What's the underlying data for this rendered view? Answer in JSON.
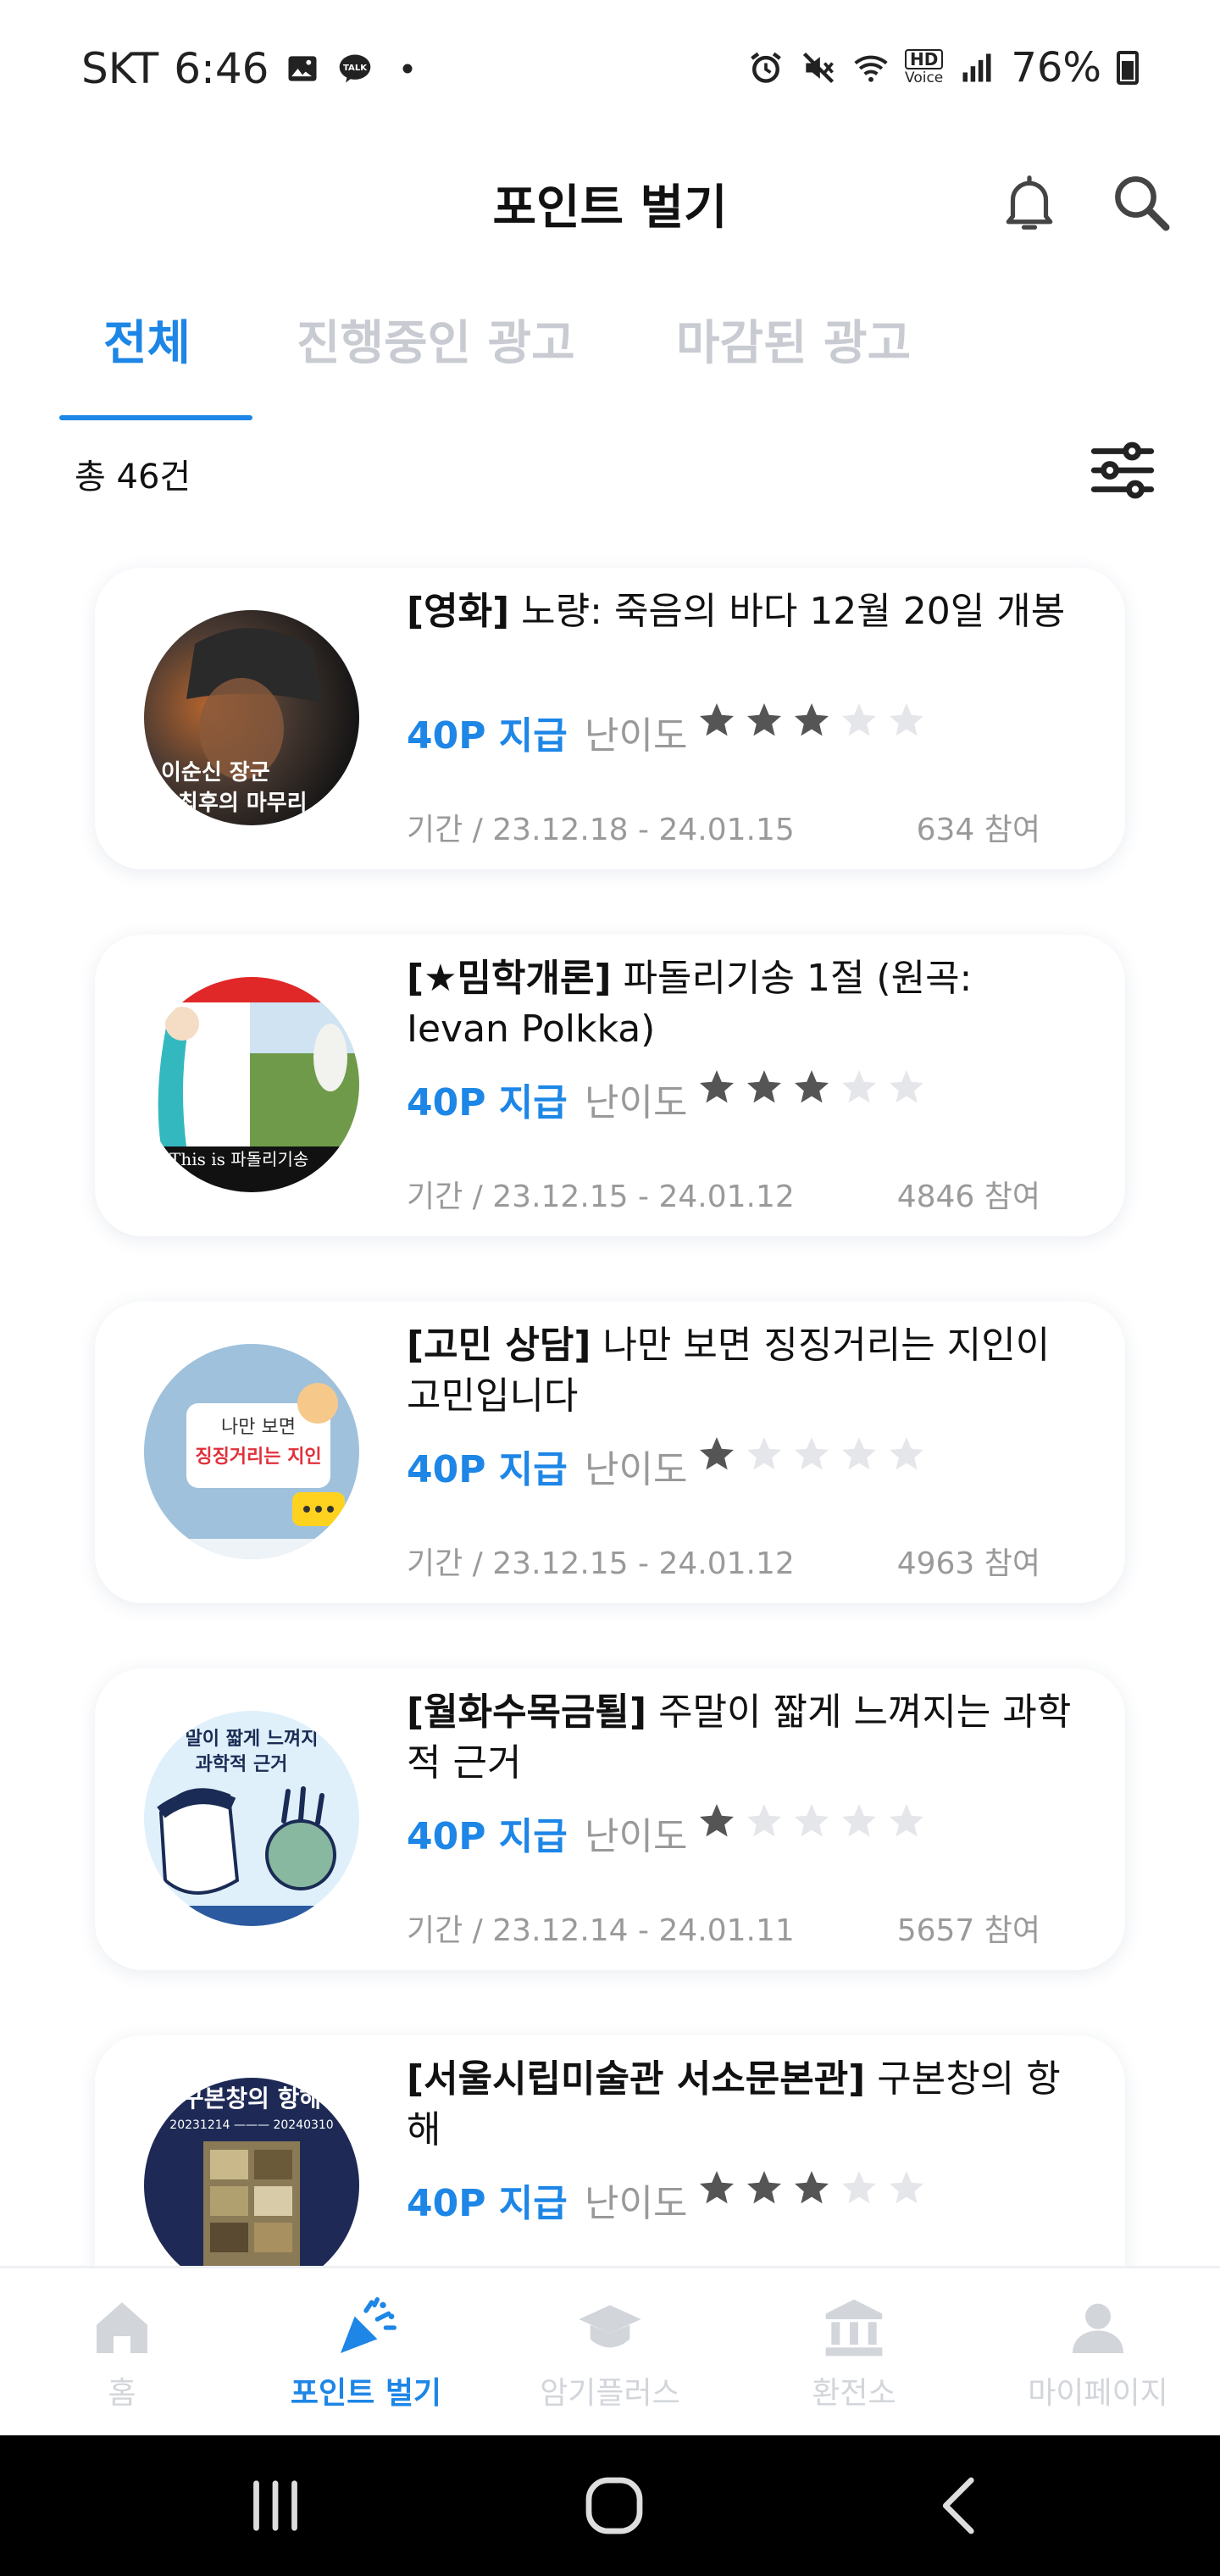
{
  "status_bar": {
    "carrier": "SKT",
    "time": "6:46",
    "hd_label_top": "HD",
    "hd_label_bottom": "Voice",
    "battery": "76%"
  },
  "header": {
    "title": "포인트 벌기"
  },
  "tabs": [
    {
      "label": "전체",
      "active": true
    },
    {
      "label": "진행중인 광고",
      "active": false
    },
    {
      "label": "마감된 광고",
      "active": false
    }
  ],
  "list_info": {
    "count": "총 46건"
  },
  "cards": [
    {
      "category": "[영화]",
      "title": " 노량: 죽음의 바다 12월 20일 개봉",
      "points": "40P 지급",
      "difficulty_label": "난이도",
      "difficulty": 3,
      "period": "기간 /   23.12.18 - 24.01.15",
      "participants": "634 참여",
      "thumb_text": "이순신 장군\n최후의 마무리"
    },
    {
      "category": "[★밈학개론]",
      "title": " 파돌리기송 1절 (원곡: Ievan Polkka)",
      "points": "40P 지급",
      "difficulty_label": "난이도",
      "difficulty": 3,
      "period": "기간 /   23.12.15 - 24.01.12",
      "participants": "4846 참여",
      "thumb_text": "This is 파돌리기송"
    },
    {
      "category": "[고민 상담]",
      "title": " 나만 보면 징징거리는 지인이 고민입니다",
      "points": "40P 지급",
      "difficulty_label": "난이도",
      "difficulty": 1,
      "period": "기간 /   23.12.15 - 24.01.12",
      "participants": "4963 참여",
      "thumb_text_1": "나만 보면",
      "thumb_text_2": "징징거리는 지인"
    },
    {
      "category": "[월화수목금퇼]",
      "title": " 주말이 짧게 느껴지는 과학적 근거",
      "points": "40P 지급",
      "difficulty_label": "난이도",
      "difficulty": 1,
      "period": "기간 /   23.12.14 - 24.01.11",
      "participants": "5657 참여",
      "thumb_text_1": "말이 짧게 느껴지",
      "thumb_text_2": "과학적 근거"
    },
    {
      "category": "[서울시립미술관 서소문본관]",
      "title": " 구본창의 항해",
      "points": "40P 지급",
      "difficulty_label": "난이도",
      "difficulty": 3,
      "thumb_text_1": "구본창의 항해",
      "thumb_text_2": "20231214 ——— 20240310"
    }
  ],
  "bottom_nav": [
    {
      "label": "홈",
      "icon": "home-icon",
      "active": false
    },
    {
      "label": "포인트 벌기",
      "icon": "party-popper-icon",
      "active": true
    },
    {
      "label": "암기플러스",
      "icon": "graduation-cap-icon",
      "active": false
    },
    {
      "label": "환전소",
      "icon": "bank-icon",
      "active": false
    },
    {
      "label": "마이페이지",
      "icon": "person-icon",
      "active": false
    }
  ],
  "colors": {
    "accent": "#1d86e6",
    "inactive": "#c8cbd1",
    "star_filled": "#555555",
    "star_empty": "#e5e6e9"
  }
}
